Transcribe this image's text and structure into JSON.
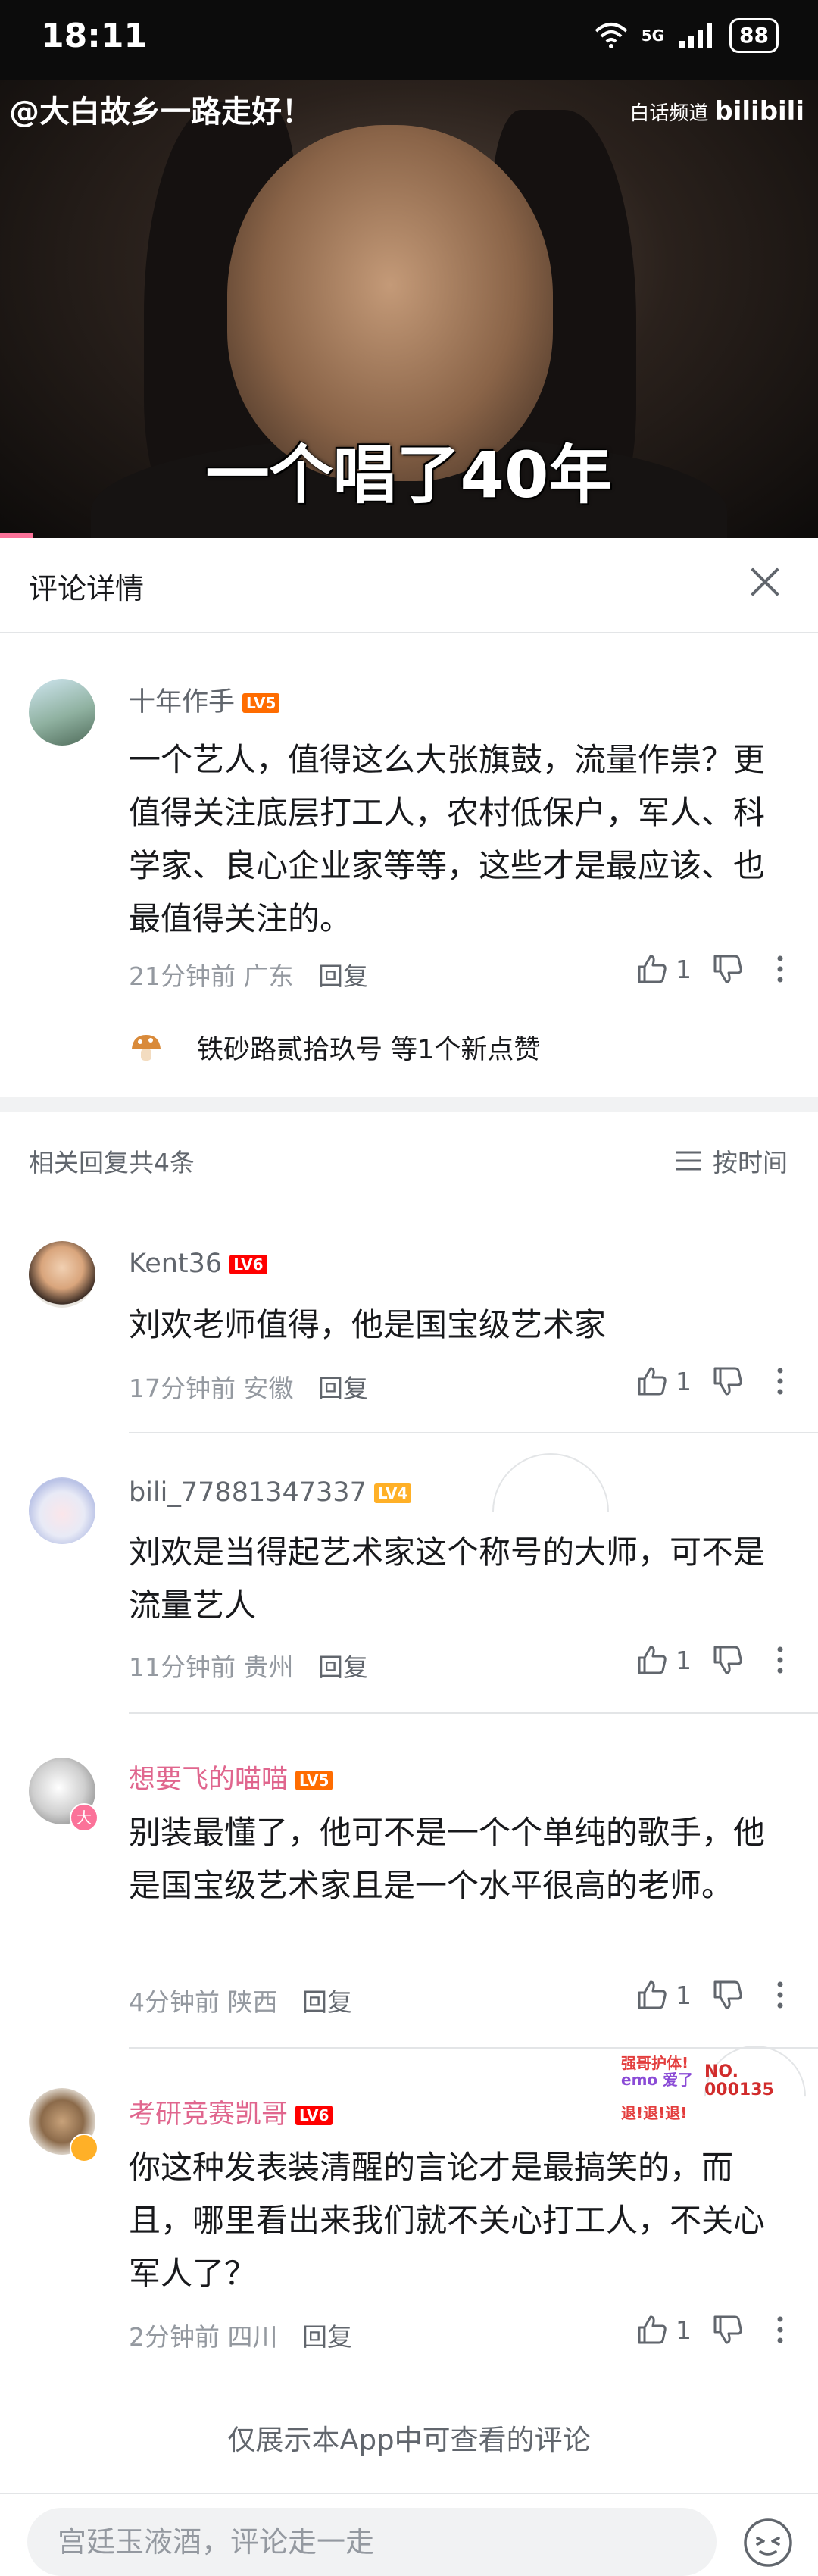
{
  "status_bar": {
    "time": "18:11",
    "network": "5G",
    "battery": "88"
  },
  "video": {
    "watermark_left": "@大白故乡一路走好！",
    "watermark_right": "白话频道",
    "watermark_brand": "bilibili",
    "subtitle": "一个唱了40年",
    "progress": 0.04
  },
  "panel": {
    "title": "评论详情"
  },
  "main_comment": {
    "user": "十年作手",
    "level": "LV5",
    "text": "一个艺人，值得这么大张旗鼓，流量作祟？更值得关注底层打工人，农村低保户，军人、科学家、良心企业家等等，这些才是最应该、也最值得关注的。",
    "time": "21分钟前",
    "location": "广东",
    "reply_label": "回复",
    "likes": "1",
    "likers_text": "铁砂路贰拾玖号 等1个新点赞"
  },
  "replies_header": {
    "count_text": "相关回复共4条",
    "sort_label": "按时间"
  },
  "replies": [
    {
      "user": "Kent36",
      "level": "LV6",
      "text": "刘欢老师值得，他是国宝级艺术家",
      "time": "17分钟前",
      "location": "安徽",
      "reply_label": "回复",
      "likes": "1"
    },
    {
      "user": "bili_77881347337",
      "level": "LV4",
      "text": "刘欢是当得起艺术家这个称号的大师，可不是流量艺人",
      "time": "11分钟前",
      "location": "贵州",
      "reply_label": "回复",
      "likes": "1"
    },
    {
      "user": "想要飞的喵喵",
      "level": "LV5",
      "avatar_badge": "大",
      "text": "别装最懂了，他可不是一个个单纯的歌手，他是国宝级艺术家且是一个水平很高的老师。",
      "time": "4分钟前",
      "location": "陕西",
      "reply_label": "回复",
      "likes": "1"
    },
    {
      "user": "考研竞赛凯哥",
      "level": "LV6",
      "text": "你这种发表装清醒的言论才是最搞笑的，而且，哪里看出来我们就不关心打工人，不关心军人了？",
      "time": "2分钟前",
      "location": "四川",
      "reply_label": "回复",
      "likes": "1"
    }
  ],
  "sticker": {
    "line1": "强哥护体!",
    "line2": "emo 爱了",
    "line3": "NO.",
    "line4": "000135",
    "line5": "退!退!退!"
  },
  "footer_note": "仅展示本App中可查看的评论",
  "input": {
    "placeholder": "宫廷玉液酒，评论走一走"
  },
  "colors": {
    "accent": "#fb7299",
    "pink_name": "#e0668e",
    "gray": "#61666d",
    "light_gray": "#9499a0"
  }
}
